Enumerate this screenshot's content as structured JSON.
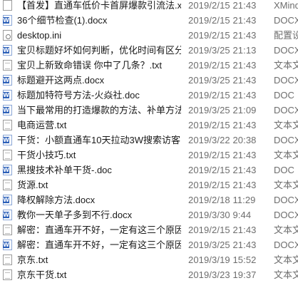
{
  "files": [
    {
      "name": "【首发】直通车低价卡首屏爆款引流法.x",
      "date": "2019/2/15 21:43",
      "type": "XMind",
      "icon": "generic-file-icon"
    },
    {
      "name": "36个细节检查(1).docx",
      "date": "2019/2/15 21:43",
      "type": "DOCX",
      "icon": "word-doc-icon"
    },
    {
      "name": "desktop.ini",
      "date": "2019/2/15 21:43",
      "type": "配置设",
      "icon": "settings-file-icon"
    },
    {
      "name": "宝贝标题好坏如何判断，优化时间有区分",
      "date": "2019/3/25 21:13",
      "type": "DOCX",
      "icon": "word-doc-icon"
    },
    {
      "name": "宝贝上新致命错误 你中了几条？.txt",
      "date": "2019/2/15 21:43",
      "type": "文本文",
      "icon": "text-file-icon"
    },
    {
      "name": "标题避开这两点.docx",
      "date": "2019/3/25 21:43",
      "type": "DOCX",
      "icon": "word-doc-icon"
    },
    {
      "name": "标题加特符号方法-火焱社.doc",
      "date": "2019/2/15 21:43",
      "type": "DOC",
      "icon": "word-doc-icon"
    },
    {
      "name": "当下最常用的打造爆款的方法、补单方法",
      "date": "2019/3/25 21:09",
      "type": "DOCX",
      "icon": "word-doc-icon"
    },
    {
      "name": "电商运营.txt",
      "date": "2019/2/15 21:43",
      "type": "文本文",
      "icon": "text-file-icon"
    },
    {
      "name": "干货：小额直通车10天拉动3W搜索访客",
      "date": "2019/3/22 20:38",
      "type": "DOCX",
      "icon": "word-doc-icon"
    },
    {
      "name": "干货小技巧.txt",
      "date": "2019/2/15 21:43",
      "type": "文本文",
      "icon": "text-file-icon"
    },
    {
      "name": "黑搜技术补单干货-.doc",
      "date": "2019/2/15 21:43",
      "type": "DOC",
      "icon": "word-doc-icon"
    },
    {
      "name": "货源.txt",
      "date": "2019/2/15 21:43",
      "type": "文本文",
      "icon": "text-file-icon"
    },
    {
      "name": "降权解除方法.docx",
      "date": "2019/2/18 11:29",
      "type": "DOCX",
      "icon": "word-doc-icon"
    },
    {
      "name": "教你一天单子多到不行.docx",
      "date": "2019/3/30 9:44",
      "type": "DOCX",
      "icon": "word-doc-icon"
    },
    {
      "name": "解密：直通车开不好，一定有这三个原因",
      "date": "2019/2/15 21:43",
      "type": "文本文",
      "icon": "text-file-icon"
    },
    {
      "name": "解密：直通车开不好，一定有这三个原因",
      "date": "2019/3/25 21:43",
      "type": "DOCX",
      "icon": "word-doc-icon"
    },
    {
      "name": "京东.txt",
      "date": "2019/3/19 15:52",
      "type": "文本文",
      "icon": "text-file-icon"
    },
    {
      "name": "京东干货.txt",
      "date": "2019/3/23 19:37",
      "type": "文本文",
      "icon": "text-file-icon"
    }
  ]
}
